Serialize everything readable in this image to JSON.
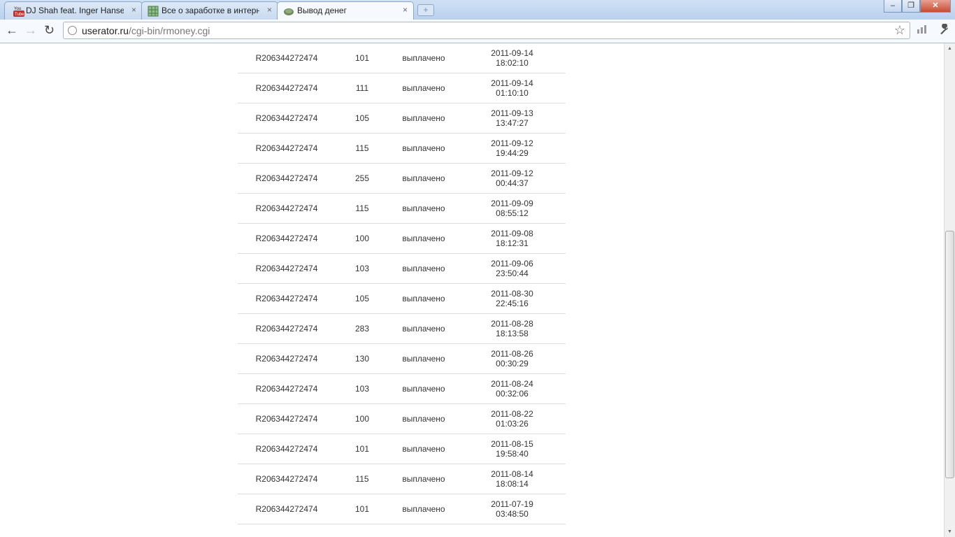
{
  "tabs": [
    {
      "title": "DJ Shah feat. Inger Hansen",
      "favicon": "youtube-icon",
      "close": "×"
    },
    {
      "title": "Все о заработке в интерне",
      "favicon": "grid-favicon-icon",
      "close": "×"
    },
    {
      "title": "Вывод денег",
      "favicon": "userator-favicon-icon",
      "close": "×"
    }
  ],
  "window_controls": {
    "minimize": "–",
    "maximize": "❐",
    "close": "✕"
  },
  "address_bar": {
    "domain": "userator.ru",
    "path": "/cgi-bin/rmoney.cgi"
  },
  "colors": {
    "accent": "#8aa8cf",
    "close_button": "#c84c32"
  },
  "payouts": [
    {
      "purse": "R206344272474",
      "amount": "101",
      "status": "выплачено",
      "date": "2011-09-14",
      "time": "18:02:10"
    },
    {
      "purse": "R206344272474",
      "amount": "111",
      "status": "выплачено",
      "date": "2011-09-14",
      "time": "01:10:10"
    },
    {
      "purse": "R206344272474",
      "amount": "105",
      "status": "выплачено",
      "date": "2011-09-13",
      "time": "13:47:27"
    },
    {
      "purse": "R206344272474",
      "amount": "115",
      "status": "выплачено",
      "date": "2011-09-12",
      "time": "19:44:29"
    },
    {
      "purse": "R206344272474",
      "amount": "255",
      "status": "выплачено",
      "date": "2011-09-12",
      "time": "00:44:37"
    },
    {
      "purse": "R206344272474",
      "amount": "115",
      "status": "выплачено",
      "date": "2011-09-09",
      "time": "08:55:12"
    },
    {
      "purse": "R206344272474",
      "amount": "100",
      "status": "выплачено",
      "date": "2011-09-08",
      "time": "18:12:31"
    },
    {
      "purse": "R206344272474",
      "amount": "103",
      "status": "выплачено",
      "date": "2011-09-06",
      "time": "23:50:44"
    },
    {
      "purse": "R206344272474",
      "amount": "105",
      "status": "выплачено",
      "date": "2011-08-30",
      "time": "22:45:16"
    },
    {
      "purse": "R206344272474",
      "amount": "283",
      "status": "выплачено",
      "date": "2011-08-28",
      "time": "18:13:58"
    },
    {
      "purse": "R206344272474",
      "amount": "130",
      "status": "выплачено",
      "date": "2011-08-26",
      "time": "00:30:29"
    },
    {
      "purse": "R206344272474",
      "amount": "103",
      "status": "выплачено",
      "date": "2011-08-24",
      "time": "00:32:06"
    },
    {
      "purse": "R206344272474",
      "amount": "100",
      "status": "выплачено",
      "date": "2011-08-22",
      "time": "01:03:26"
    },
    {
      "purse": "R206344272474",
      "amount": "101",
      "status": "выплачено",
      "date": "2011-08-15",
      "time": "19:58:40"
    },
    {
      "purse": "R206344272474",
      "amount": "115",
      "status": "выплачено",
      "date": "2011-08-14",
      "time": "18:08:14"
    },
    {
      "purse": "R206344272474",
      "amount": "101",
      "status": "выплачено",
      "date": "2011-07-19",
      "time": "03:48:50"
    }
  ]
}
